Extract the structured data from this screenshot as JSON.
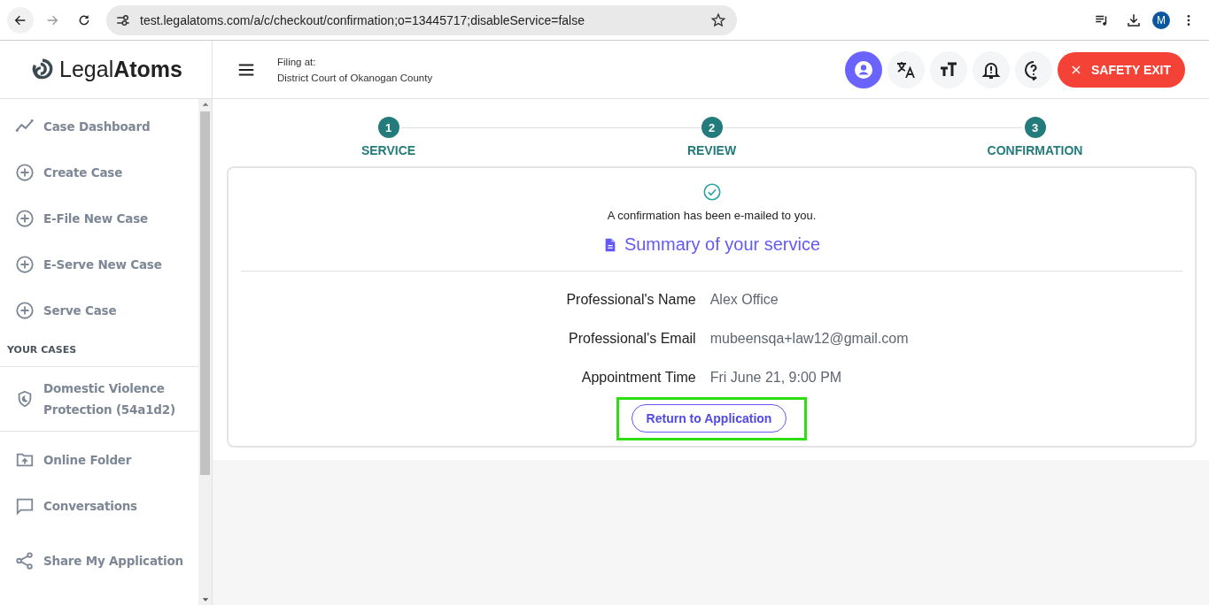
{
  "browser": {
    "url": "test.legalatoms.com/a/c/checkout/confirmation;o=13445717;disableService=false",
    "avatar": "M"
  },
  "header": {
    "logo_light": "Legal",
    "logo_bold": "Atoms",
    "filing_label": "Filing at:",
    "filing_court": "District Court of Okanogan County",
    "icon_buttons": [
      {
        "kind": "profile",
        "active": true
      },
      {
        "kind": "translate",
        "active": false
      },
      {
        "kind": "text-size",
        "active": false
      },
      {
        "kind": "bell",
        "active": false
      },
      {
        "kind": "help",
        "active": false
      }
    ],
    "exit_button": "SAFETY EXIT"
  },
  "sidebar": {
    "items": [
      {
        "kind": "chart",
        "label": "Case Dashboard"
      },
      {
        "kind": "plus",
        "label": "Create Case"
      },
      {
        "kind": "plus",
        "label": "E-File New Case"
      },
      {
        "kind": "plus",
        "label": "E-Serve New Case"
      },
      {
        "kind": "plus",
        "label": "Serve Case"
      }
    ],
    "section_title": "YOUR CASES",
    "cases": [
      {
        "kind": "shield",
        "label": "Domestic Violence Protection (54a1d2)"
      }
    ],
    "tools": [
      {
        "kind": "folder",
        "label": "Online Folder"
      },
      {
        "kind": "chat",
        "label": "Conversations"
      },
      {
        "kind": "share",
        "label": "Share My Application"
      }
    ]
  },
  "steps": [
    {
      "number": "1",
      "label": "SERVICE",
      "done": true
    },
    {
      "number": "2",
      "label": "REVIEW",
      "done": true
    },
    {
      "number": "3",
      "label": "CONFIRMATION",
      "done": true
    }
  ],
  "confirmation": {
    "message": "A confirmation has been e-mailed to you.",
    "summary_title": "Summary of your service",
    "fields": [
      {
        "label": "Professional's Name",
        "value": "Alex Office"
      },
      {
        "label": "Professional's Email",
        "value": "mubeensqa+law12@gmail.com"
      },
      {
        "label": "Appointment Time",
        "value": "Fri June 21, 9:00 PM"
      }
    ],
    "button": "Return to Application",
    "highlighted": true
  }
}
